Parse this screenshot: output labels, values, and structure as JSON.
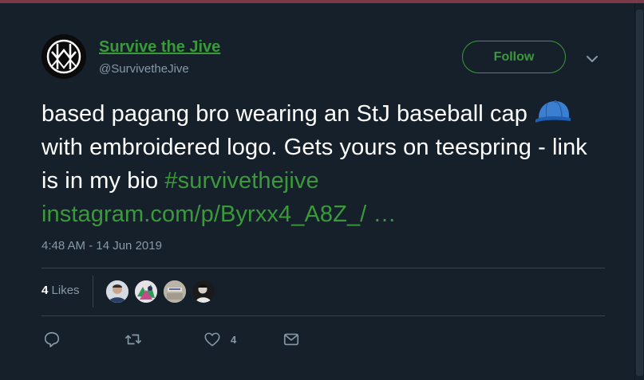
{
  "account": {
    "display_name": "Survive the Jive",
    "handle": "@SurvivetheJive"
  },
  "follow_label": "Follow",
  "tweet": {
    "text_part1": "based pagang bro wearing an StJ baseball cap ",
    "emoji": "baseball-cap-icon",
    "text_part2": " with embroidered logo. Gets yours on teespring - link is in my bio ",
    "hashtag": "#survivethejive",
    "link": "instagram.com/p/Byrxx4_A8Z_/ …"
  },
  "timestamp": "4:48 AM - 14 Jun 2019",
  "likes": {
    "count": "4",
    "label": "Likes"
  },
  "actions": {
    "reply_icon": "reply-icon",
    "retweet_icon": "retweet-icon",
    "like_icon": "heart-icon",
    "like_count": "4",
    "dm_icon": "envelope-icon"
  },
  "colors": {
    "background": "#15202b",
    "accent": "#3a9a3a",
    "secondary_text": "#8899a6",
    "divider": "#38444d"
  }
}
